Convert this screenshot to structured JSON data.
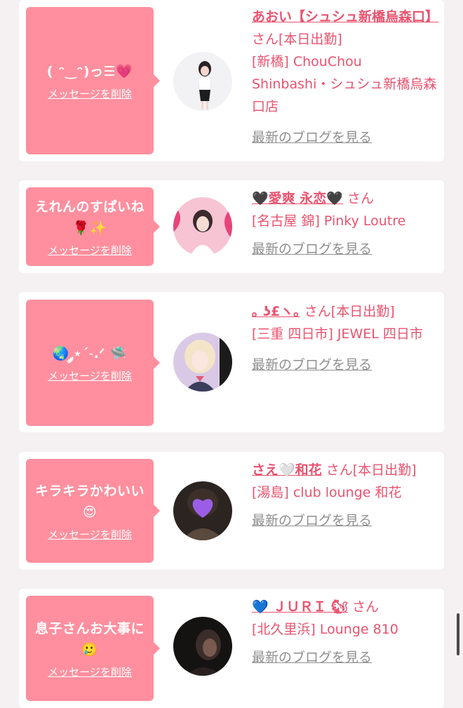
{
  "entries": [
    {
      "message": "( ᵔ‿ᵔ)っ☰💗",
      "delete_label": "メッセージを削除",
      "name": "あおい【シュシュ新橋烏森口】",
      "san": "さん",
      "status": "[本日出勤]",
      "shop": "[新橋] ChouChou Shinbashi・シュシュ新橋烏森口店",
      "blog_label": "最新のブログを見る",
      "avatar_icon": "woman-portrait-avatar"
    },
    {
      "message": "えれんのすぱいね🌹✨",
      "delete_label": "メッセージを削除",
      "name": "🖤愛爽 永恋🖤",
      "san": "さん",
      "status": "",
      "shop": "[名古屋 錦] Pinky Loutre",
      "blog_label": "最新のブログを見る",
      "avatar_icon": "pink-portrait-avatar"
    },
    {
      "message": "🌏 ༘⋆ˊ˗.ᐟ 🛸",
      "delete_label": "メッセージを削除",
      "name": "｡ ʖ£ヽ｡",
      "san": "さん",
      "status": "[本日出勤]",
      "shop": "[三重 四日市] JEWEL 四日市",
      "blog_label": "最新のブログを見る",
      "avatar_icon": "doll-portrait-avatar"
    },
    {
      "message": "キラキラかわいい😍",
      "delete_label": "メッセージを削除",
      "name": "さえ🤍和花",
      "san": "さん",
      "status": "[本日出勤]",
      "shop": "[湯島] club lounge 和花",
      "blog_label": "最新のブログを見る",
      "avatar_icon": "purple-heart-avatar"
    },
    {
      "message": "息子さんお大事に🥲",
      "delete_label": "メッセージを削除",
      "name": "💙 ＪＵＲＩ 🐿",
      "san": "さん",
      "status": "",
      "shop": "[北久里浜] Lounge 810",
      "blog_label": "最新のブログを見る",
      "avatar_icon": "dark-portrait-avatar"
    }
  ]
}
